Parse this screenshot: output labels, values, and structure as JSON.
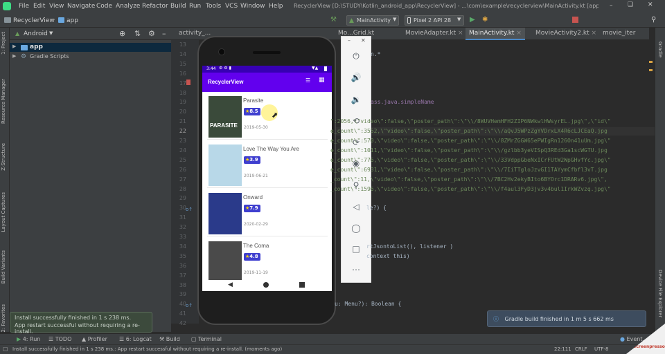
{
  "title_bar": {
    "menus": [
      "File",
      "Edit",
      "View",
      "Navigate",
      "Code",
      "Analyze",
      "Refactor",
      "Build",
      "Run",
      "Tools",
      "VCS",
      "Window",
      "Help"
    ],
    "window_title": "RecyclerView [D:\\STUDY\\Kotlin_android_app\\RecyclerView] - ...\\com\\example\\recyclerview\\MainActivity.kt [app]"
  },
  "nav_bar": {
    "breadcrumb_root": "RecyclerView",
    "breadcrumb_module": "app",
    "run_config": "MainActivity",
    "device": "Pixel 2 API 28"
  },
  "project_panel": {
    "view_mode": "Android",
    "items": [
      {
        "label": "app"
      },
      {
        "label": "Gradle Scripts"
      }
    ]
  },
  "left_strip": {
    "labels": [
      "1: Project",
      "Resource Manager",
      "Z-Structure",
      "Layout Captures",
      "Build Variants",
      "2: Favorites"
    ]
  },
  "right_strip": {
    "labels": [
      "Gradle",
      "Device File Explorer"
    ]
  },
  "tabs": [
    {
      "label": "activity_..."
    },
    {
      "label": "Mo...Grid.kt"
    },
    {
      "label": "MovieAdapter.kt"
    },
    {
      "label": "MainActivity.kt",
      "active": true
    },
    {
      "label": "MovieActivity2.kt"
    },
    {
      "label": "movie_iter"
    }
  ],
  "editor": {
    "line_numbers": [
      "13",
      "14",
      "15",
      "16",
      "17",
      "18",
      "19",
      "20",
      "21",
      "22",
      "23",
      "24",
      "25",
      "26",
      "27",
      "28",
      "29",
      "30",
      "31",
      "32",
      "33",
      "34",
      "35",
      "36",
      "37",
      "38",
      "39",
      "40",
      "41",
      "42"
    ],
    "code_lines": [
      {
        "text": "n.*"
      },
      {
        "text": "ass.java.simpleName"
      },
      {
        "text": "\":2056,\\\"video\\\":false,\\\"poster_path\\\":\\\"\\\\/8WUVHemHFH2ZIP6NWkwlHWsyrEL.jpg\\\",\\\"id\\\""
      },
      {
        "text": "e_count\\\":3552,\\\"video\\\":false,\\\"poster_path\\\":\\\"\\\\/aQvJ5WPzZgYVDrxLX4R6cLJCEaQ.jpg"
      },
      {
        "text": "e_count\\\":570,\\\"video\\\":false,\\\"poster_path\\\":\\\"\\\\/8ZMrZGGW65ePWIgRn126On41uUm.jpg\\\""
      },
      {
        "text": "e_count\\\":1011,\\\"video\\\":false,\\\"poster_path\\\":\\\"\\\\/gzlbb3yeVISpQ3REd3Ga1scWGTU.jpg"
      },
      {
        "text": "e_count\\\":776,\\\"video\\\":false,\\\"poster_path\\\":\\\"\\\\/33VdppGbeNxICrFUtW2WpGHvfYc.jpg\\\""
      },
      {
        "text": "e_count\\\":6931,\\\"video\\\":false,\\\"poster_path\\\":\\\"\\\\/7IiTTgloJzvGI1TAYymCfbfl3vT.jpg"
      },
      {
        "text": "_count\\\":11,\\\"video\\\":false,\\\"poster_path\\\":\\\"\\\\/7BC2Hv2ekyBIto6BYOrc1DRARv6.jpg\\\","
      },
      {
        "text": "_count\\\":1596,\\\"video\\\":false,\\\"poster_path\\\":\\\"\\\\/f4aul3FyD3jv3v4bul1IrkWZvzq.jpg\\\""
      },
      {
        "text": "le?) {"
      },
      {
        "text": "rtJsontoList(), listener )"
      },
      {
        "text": "context this)"
      },
      {
        "text": "u: Menu?): Boolean {"
      }
    ]
  },
  "phone": {
    "status_time": "3:44",
    "app_title": "RecyclerView",
    "movies": [
      {
        "title": "Parasite",
        "rating": "8.5",
        "date": "2019-05-30",
        "poster_text": "PARASITE",
        "poster_color": "#3a4a3a"
      },
      {
        "title": "Love The Way You Are",
        "rating": "3.9",
        "date": "2019-06-21",
        "poster_text": "",
        "poster_color": "#b8d8e8"
      },
      {
        "title": "Onward",
        "rating": "7.9",
        "date": "2020-02-29",
        "poster_text": "",
        "poster_color": "#2a3a8a"
      },
      {
        "title": "The Coma",
        "rating": "4.8",
        "date": "2019-11-19",
        "poster_text": "",
        "poster_color": "#4a4a4a"
      }
    ]
  },
  "emulator_toolbar": {
    "icons": [
      "power-icon",
      "volume-up-icon",
      "volume-down-icon",
      "rotate-left-icon",
      "rotate-right-icon",
      "camera-icon",
      "zoom-icon",
      "back-icon",
      "home-icon",
      "overview-icon",
      "more-icon"
    ]
  },
  "bottom_tools": [
    {
      "label": "4: Run"
    },
    {
      "label": "TODO"
    },
    {
      "label": "Profiler"
    },
    {
      "label": "6: Logcat"
    },
    {
      "label": "Build"
    },
    {
      "label": "Terminal"
    }
  ],
  "event_log": "Event...",
  "toasts": {
    "left_line1": "Install successfully finished in 1 s 238 ms.",
    "left_line2": "App restart successful without requiring a re-install.",
    "right": "Gradle build finished in 1 m 5 s 662 ms"
  },
  "status_bar": {
    "message": "Install successfully finished in 1 s 238 ms.: App restart successful without requiring a re-install. (moments ago)",
    "position": "22:111",
    "line_sep": "CRLF",
    "encoding": "UTF-8"
  },
  "watermark": "Screenpresso",
  "colors": {
    "accent": "#6200ee",
    "status_strip": "#3700b3",
    "badge": "#3f3fcf",
    "ide_bg": "#2b2b2b",
    "ide_panel": "#3c3f41"
  }
}
